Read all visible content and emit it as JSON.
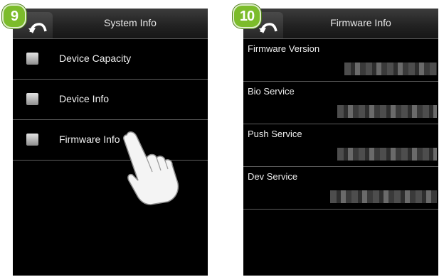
{
  "step_badges": [
    "9",
    "10"
  ],
  "screen1": {
    "title": "System Info",
    "back_icon": "back-arrow-icon",
    "items": [
      {
        "label": "Device Capacity",
        "icon": "device-capacity-icon"
      },
      {
        "label": "Device Info",
        "icon": "device-info-icon"
      },
      {
        "label": "Firmware Info",
        "icon": "firmware-info-icon"
      }
    ]
  },
  "screen2": {
    "title": "Firmware Info",
    "back_icon": "back-arrow-icon",
    "fields": [
      {
        "label": "Firmware Version"
      },
      {
        "label": "Bio Service"
      },
      {
        "label": "Push Service"
      },
      {
        "label": "Dev Service"
      }
    ]
  },
  "colors": {
    "badge": "#7cbc2b",
    "screen_bg": "#000000",
    "divider": "#5d5d5d"
  }
}
